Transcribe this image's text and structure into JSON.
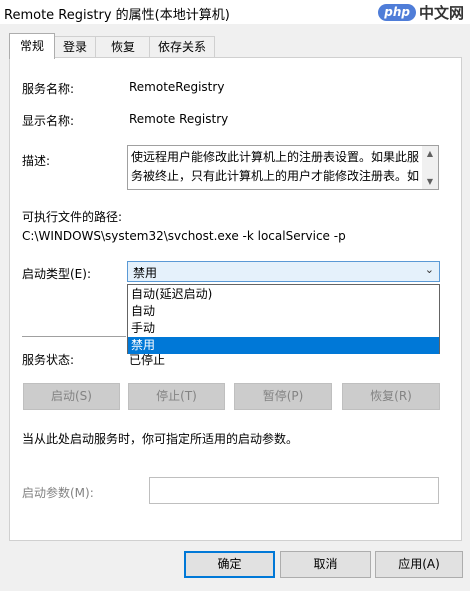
{
  "window": {
    "title": "Remote Registry 的属性(本地计算机)"
  },
  "watermark": {
    "logo": "php",
    "text": "中文网"
  },
  "tabs": [
    {
      "label": "常规",
      "active": true
    },
    {
      "label": "登录",
      "active": false
    },
    {
      "label": "恢复",
      "active": false
    },
    {
      "label": "依存关系",
      "active": false
    }
  ],
  "general": {
    "service_name_label": "服务名称:",
    "service_name": "RemoteRegistry",
    "display_name_label": "显示名称:",
    "display_name": "Remote Registry",
    "description_label": "描述:",
    "description": "使远程用户能修改此计算机上的注册表设置。如果此服务被终止，只有此计算机上的用户才能修改注册表。如",
    "exe_path_label": "可执行文件的路径:",
    "exe_path": "C:\\WINDOWS\\system32\\svchost.exe -k localService -p",
    "startup_type_label": "启动类型(E):",
    "startup_type_value": "禁用",
    "startup_options": [
      {
        "label": "自动(延迟启动)",
        "selected": false
      },
      {
        "label": "自动",
        "selected": false
      },
      {
        "label": "手动",
        "selected": false
      },
      {
        "label": "禁用",
        "selected": true
      }
    ],
    "status_label": "服务状态:",
    "status_value": "已停止",
    "buttons": {
      "start": "启动(S)",
      "stop": "停止(T)",
      "pause": "暂停(P)",
      "resume": "恢复(R)"
    },
    "hint": "当从此处启动服务时，你可指定所适用的启动参数。",
    "params_label": "启动参数(M):",
    "params_value": ""
  },
  "footer": {
    "ok": "确定",
    "cancel": "取消",
    "apply": "应用(A)"
  },
  "colors": {
    "accent": "#0078d7",
    "select_bg": "#e5f1fb",
    "select_border": "#5a99d5"
  }
}
